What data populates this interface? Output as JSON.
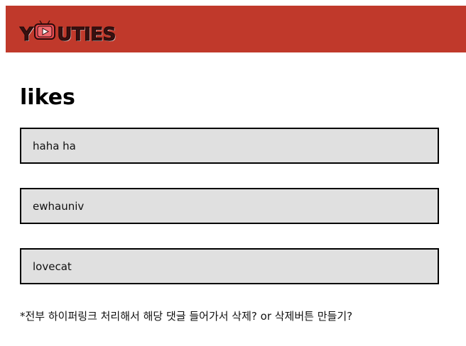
{
  "header": {
    "logo_text_before": "Y",
    "logo_text_after": "UTIES",
    "accent_color": "#c0392b"
  },
  "main": {
    "title": "likes",
    "likes": [
      "haha ha",
      "ewhauniv",
      "lovecat"
    ],
    "note": "*전부 하이퍼링크 처리해서 해당 댓글 들어가서 삭제? or 삭제버튼 만들기?"
  }
}
